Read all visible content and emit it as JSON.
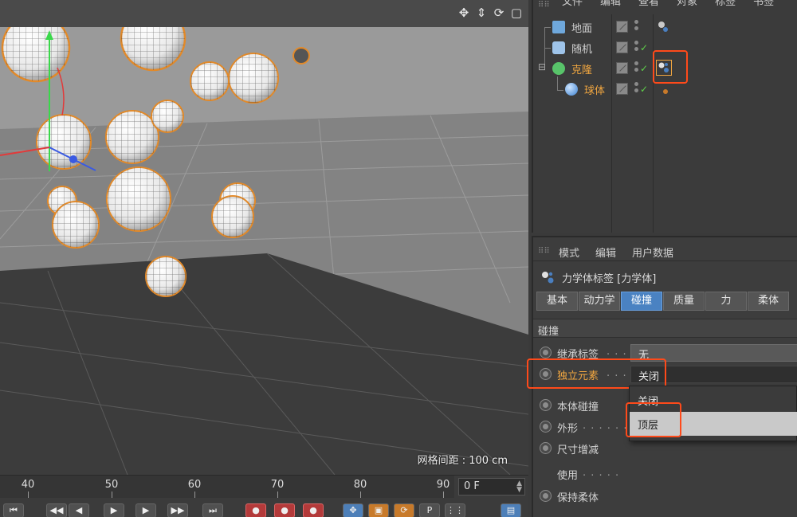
{
  "viewport": {
    "grid_label": "网格间距 : 100 cm",
    "nav_icons": [
      "move-view-icon",
      "dolly-view-icon",
      "rotate-view-icon",
      "maximize-view-icon"
    ]
  },
  "timeline": {
    "ticks": [
      "40",
      "50",
      "60",
      "70",
      "80",
      "90"
    ],
    "current_frame": "0 F"
  },
  "object_manager": {
    "menu": [
      "文件",
      "编辑",
      "查看",
      "对象",
      "标签",
      "书签"
    ],
    "objects": [
      {
        "name": "地面",
        "icon": "floor-icon",
        "active": false
      },
      {
        "name": "随机",
        "icon": "random-effector-icon",
        "active": false
      },
      {
        "name": "克隆",
        "icon": "cloner-icon",
        "active": true
      },
      {
        "name": "球体",
        "icon": "sphere-icon",
        "active": true
      }
    ]
  },
  "attribute_manager": {
    "menu": [
      "模式",
      "编辑",
      "用户数据"
    ],
    "title": "力学体标签 [力学体]",
    "tabs": [
      "基本",
      "动力学",
      "碰撞",
      "质量",
      "力",
      "柔体"
    ],
    "active_tab": "碰撞",
    "section": "碰撞",
    "properties": [
      {
        "label": "继承标签",
        "value": "无"
      },
      {
        "label": "独立元素",
        "value": "关闭"
      },
      {
        "label": "本体碰撞",
        "value": ""
      },
      {
        "label": "外形",
        "value": ""
      },
      {
        "label": "尺寸增减",
        "value": ""
      },
      {
        "label": "使用",
        "value": ""
      },
      {
        "label": "保持柔体",
        "value": ""
      }
    ],
    "dropdown_options": [
      "关闭",
      "顶层"
    ],
    "dropdown_selected": "顶层"
  },
  "colors": {
    "highlight": "#ff4a1a",
    "active_text": "#f0a640",
    "active_tab": "#4a82c2"
  }
}
